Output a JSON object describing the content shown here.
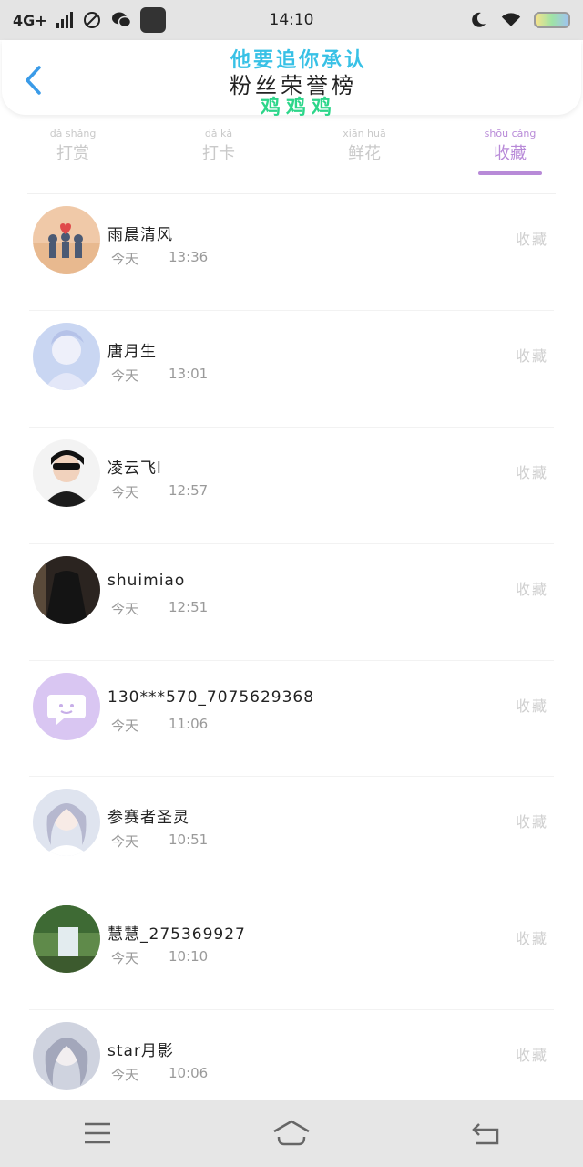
{
  "status_bar": {
    "network": "4G+",
    "time": "14:10"
  },
  "header": {
    "title": "粉丝荣誉榜",
    "banner_line1": "他要追你承认",
    "banner_line2": "鸡鸡鸡"
  },
  "tabs": [
    {
      "label": "打赏",
      "pinyin": "dǎ shǎng",
      "active": false
    },
    {
      "label": "打卡",
      "pinyin": "dǎ kǎ",
      "active": false
    },
    {
      "label": "鲜花",
      "pinyin": "xiān huā",
      "active": false
    },
    {
      "label": "收藏",
      "pinyin": "shōu cáng",
      "active": true
    }
  ],
  "list": [
    {
      "name": "雨晨清风",
      "date": "今天",
      "time": "13:36",
      "action": "收藏"
    },
    {
      "name": "唐月生",
      "date": "今天",
      "time": "13:01",
      "action": "收藏"
    },
    {
      "name": "凌云飞l",
      "date": "今天",
      "time": "12:57",
      "action": "收藏"
    },
    {
      "name": "shuimiao",
      "date": "今天",
      "time": "12:51",
      "action": "收藏"
    },
    {
      "name": "130***570_7075629368",
      "date": "今天",
      "time": "11:06",
      "action": "收藏"
    },
    {
      "name": "参赛者圣灵",
      "date": "今天",
      "time": "10:51",
      "action": "收藏"
    },
    {
      "name": "慧慧_275369927",
      "date": "今天",
      "time": "10:10",
      "action": "收藏"
    },
    {
      "name": "star月影",
      "date": "今天",
      "time": "10:06",
      "action": "收藏"
    }
  ],
  "colors": {
    "accent": "#b88ad8",
    "back_arrow": "#3a9be8",
    "muted": "#c9c9c9"
  }
}
